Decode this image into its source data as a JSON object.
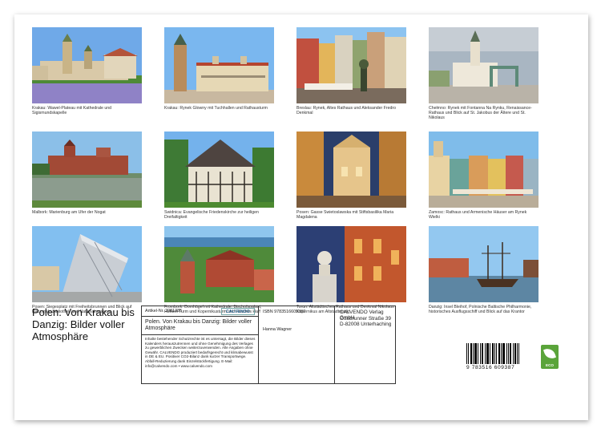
{
  "title": "Polen. Von Krakau bis Danzig: Bilder voller Atmosphäre",
  "photos": [
    {
      "caption": "Krakau: Wawel-Plateau mit Kathedrale und Sigismundskapelle"
    },
    {
      "caption": "Krakau: Rynek Glowny mit Tuchhallen und Rathausturm"
    },
    {
      "caption": "Breslau: Rynek, Altes Rathaus und Aleksander Fredro Denkmal"
    },
    {
      "caption": "Chełmno: Rynek mit Fontanna Na Rynku, Renaissance-Rathaus und Blick auf St. Jakobus der Ältere und St. Nikolaus"
    },
    {
      "caption": "Malbork: Marienburg am Ufer der Nogat"
    },
    {
      "caption": "Swidnica: Evangelische Friedenskirche zur heiligen Dreifaltigkeit"
    },
    {
      "caption": "Posen: Gasse Swietoslawska mit Stiftsbasilika Maria Magdalena"
    },
    {
      "caption": "Zamosc: Rathaus und Armenische Häuser am Rynek Wielki"
    },
    {
      "caption": "Posen: Siegesplatz mit Freiheitsbrunnen und Blick auf Raczynski-Bibliothek und Nationalmuseum"
    },
    {
      "caption": "Frombork: Domhügel mit Kathedrale, Bischofspalast, Hohem Turm und Kopernikusturm und Frisches Haff"
    },
    {
      "caption": "Torun: Altstädtisches Rathaus und Denkmal Nikolaus Kopernikus am Altstadtmarkt"
    },
    {
      "caption": "Danzig: Insel Bleihof, Polnische Baltische Philharmonie, historisches Ausflugsschiff und Blick auf das Krantor"
    }
  ],
  "info": {
    "article_label": "Artikel-Nr. 2081385",
    "logo_text": "CALVENDO",
    "title": "Polen. Von Krakau bis Danzig: Bilder voller Atmosphäre",
    "legal": "Inhalte bestehender Schutzrechte ist es untersagt, die Bilder dieses Kalenders herauszutrennen und ohne Genehmigung des Verlages zu gewerblichen Zwecken weiterzuverwenden. Alle Angaben ohne Gewähr. CALVENDO produziert bedarfsgerecht und klimabewusst in DE & EU. Positiver CO2-Bilanz dank kurzer Transportwege. Abfall-Reduzierung dank Einzelstückfertigung. E-Mail: info@calvendo.com • www.calvendo.com",
    "isbn": "ISBN 9783516609387",
    "author": "Hanna Wagner",
    "publisher_lines": [
      "CALVENDO Verlag GmbH",
      "Ottobrunner Straße 39",
      "D-82008 Unterhaching"
    ]
  },
  "barcode": {
    "digits": "9 783516 609387"
  },
  "eco_label": "ECO",
  "colors": {
    "eco_green": "#5aa43a",
    "logo_blue": "#2a6a9a"
  }
}
